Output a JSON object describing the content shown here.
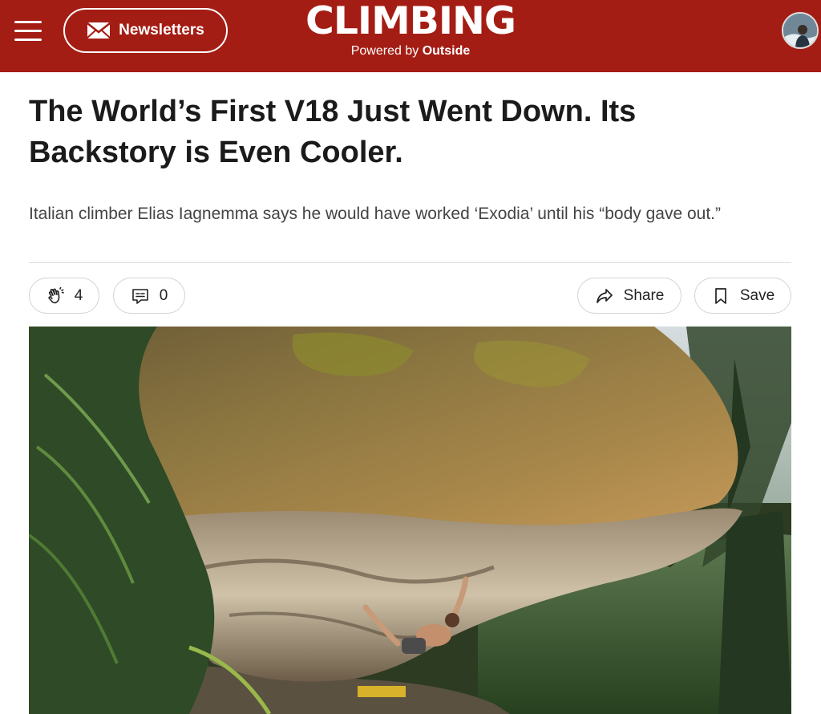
{
  "header": {
    "newsletter_label": "Newsletters",
    "brand_name": "CLIMBING",
    "tagline_prefix": "Powered by",
    "tagline_brand": "Outside",
    "background_color": "#a41d14"
  },
  "article": {
    "headline": "The World’s First V18 Just Went Down. Its Backstory is Even Cooler.",
    "dek": "Italian climber Elias Iagnemma says he would have worked ‘Exodia’ until his “body gave out.”"
  },
  "actions": {
    "claps_count": "4",
    "comments_count": "0",
    "share_label": "Share",
    "save_label": "Save"
  },
  "icons": {
    "menu": "hamburger-icon",
    "newsletter": "envelope-icon",
    "clap": "clap-icon",
    "comment": "comment-icon",
    "share": "share-arrow-icon",
    "save": "bookmark-icon"
  }
}
